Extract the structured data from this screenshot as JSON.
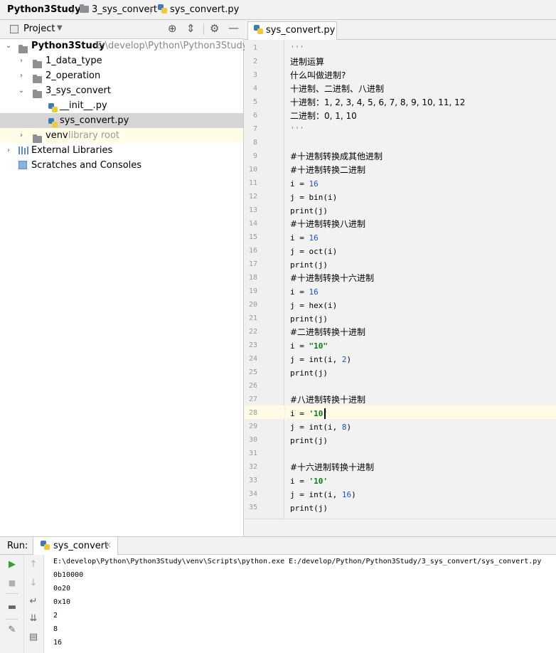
{
  "breadcrumb": {
    "project": "Python3Study",
    "folder": "3_sys_convert",
    "file": "sys_convert.py"
  },
  "project_panel": {
    "title": "Project",
    "root": {
      "name": "Python3Study",
      "path": "E:\\develop\\Python\\Python3Study"
    },
    "items": [
      {
        "label": "1_data_type"
      },
      {
        "label": "2_operation"
      },
      {
        "label": "3_sys_convert"
      },
      {
        "label": "__init__.py"
      },
      {
        "label": "sys_convert.py"
      },
      {
        "label": "venv",
        "note": "library root"
      },
      {
        "label": "External Libraries"
      },
      {
        "label": "Scratches and Consoles"
      }
    ]
  },
  "editor": {
    "tab_label": "sys_convert.py",
    "current_line": 28,
    "lines": [
      {
        "n": "1",
        "t": "'''",
        "c": "cmt"
      },
      {
        "n": "2",
        "t": "进制运算",
        "c": "zh"
      },
      {
        "n": "3",
        "t": "什么叫做进制?",
        "c": "zh"
      },
      {
        "n": "4",
        "t": "十进制、二进制、八进制",
        "c": "zh"
      },
      {
        "n": "5",
        "t": "十进制：1, 2, 3, 4, 5, 6, 7, 8, 9, 10, 11, 12",
        "c": "zh"
      },
      {
        "n": "6",
        "t": "二进制：0, 1, 10",
        "c": "zh"
      },
      {
        "n": "7",
        "t": "'''",
        "c": "cmt"
      },
      {
        "n": "8",
        "t": "",
        "c": ""
      },
      {
        "n": "9",
        "t": "#十进制转换成其他进制",
        "c": "zh"
      },
      {
        "n": "10",
        "t": "#十进制转换二进制",
        "c": "zh"
      },
      {
        "n": "11",
        "t": "i = 16",
        "c": ""
      },
      {
        "n": "12",
        "t": "j = bin(i)",
        "c": ""
      },
      {
        "n": "13",
        "t": "print(j)",
        "c": ""
      },
      {
        "n": "14",
        "t": "#十进制转换八进制",
        "c": "zh"
      },
      {
        "n": "15",
        "t": "i = 16",
        "c": ""
      },
      {
        "n": "16",
        "t": "j = oct(i)",
        "c": ""
      },
      {
        "n": "17",
        "t": "print(j)",
        "c": ""
      },
      {
        "n": "18",
        "t": "#十进制转换十六进制",
        "c": "zh"
      },
      {
        "n": "19",
        "t": "i = 16",
        "c": ""
      },
      {
        "n": "20",
        "t": "j = hex(i)",
        "c": ""
      },
      {
        "n": "21",
        "t": "print(j)",
        "c": ""
      },
      {
        "n": "22",
        "t": "#二进制转换十进制",
        "c": "zh"
      },
      {
        "n": "23",
        "t": "i = \"10\"",
        "c": ""
      },
      {
        "n": "24",
        "t": "j = int(i, 2)",
        "c": ""
      },
      {
        "n": "25",
        "t": "print(j)",
        "c": ""
      },
      {
        "n": "26",
        "t": "",
        "c": ""
      },
      {
        "n": "27",
        "t": "#八进制转换十进制",
        "c": "zh"
      },
      {
        "n": "28",
        "t": "i = '10'",
        "c": ""
      },
      {
        "n": "29",
        "t": "j = int(i, 8)",
        "c": ""
      },
      {
        "n": "30",
        "t": "print(j)",
        "c": ""
      },
      {
        "n": "31",
        "t": "",
        "c": ""
      },
      {
        "n": "32",
        "t": "#十六进制转换十进制",
        "c": "zh"
      },
      {
        "n": "33",
        "t": "i = '10'",
        "c": ""
      },
      {
        "n": "34",
        "t": "j = int(i, 16)",
        "c": ""
      },
      {
        "n": "35",
        "t": "print(j)",
        "c": ""
      }
    ]
  },
  "run_panel": {
    "label": "Run:",
    "tab_label": "sys_convert",
    "output": [
      "E:\\develop\\Python\\Python3Study\\venv\\Scripts\\python.exe E:/develop/Python/Python3Study/3_sys_convert/sys_convert.py",
      "0b10000",
      "0o20",
      "0x10",
      "2",
      "8",
      "16"
    ]
  }
}
